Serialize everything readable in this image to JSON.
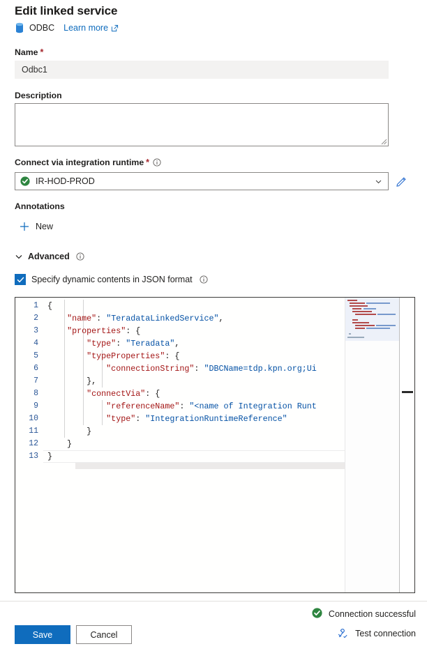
{
  "header": {
    "title": "Edit linked service",
    "service_icon": "database-icon",
    "service_name": "ODBC",
    "learn_more_label": "Learn more",
    "learn_more_icon": "external-link-icon"
  },
  "fields": {
    "name": {
      "label": "Name",
      "required_marker": "*",
      "value": "Odbc1"
    },
    "description": {
      "label": "Description",
      "value": "",
      "placeholder": ""
    },
    "integration_runtime": {
      "label": "Connect via integration runtime",
      "required_marker": "*",
      "info_icon": "info-icon",
      "value": "IR-HOD-PROD",
      "status_icon": "check-circle-green-icon",
      "chevron_icon": "chevron-down-icon",
      "edit_icon": "pencil-icon"
    }
  },
  "annotations": {
    "label": "Annotations",
    "new_label": "New",
    "new_icon": "plus-icon"
  },
  "advanced": {
    "label": "Advanced",
    "chevron_icon": "chevron-down-icon",
    "info_icon": "info-icon",
    "checkbox": {
      "label": "Specify dynamic contents in JSON format",
      "checked": true,
      "info_icon": "info-icon"
    }
  },
  "editor": {
    "line_numbers": [
      "1",
      "2",
      "3",
      "4",
      "5",
      "6",
      "7",
      "8",
      "9",
      "10",
      "11",
      "12",
      "13"
    ],
    "lines": [
      [
        {
          "t": "{",
          "c": "p"
        }
      ],
      [
        {
          "t": "    ",
          "c": "p"
        },
        {
          "t": "\"name\"",
          "c": "k"
        },
        {
          "t": ": ",
          "c": "p"
        },
        {
          "t": "\"TeradataLinkedService\"",
          "c": "s"
        },
        {
          "t": ",",
          "c": "p"
        }
      ],
      [
        {
          "t": "    ",
          "c": "p"
        },
        {
          "t": "\"properties\"",
          "c": "k"
        },
        {
          "t": ": {",
          "c": "p"
        }
      ],
      [
        {
          "t": "        ",
          "c": "p"
        },
        {
          "t": "\"type\"",
          "c": "k"
        },
        {
          "t": ": ",
          "c": "p"
        },
        {
          "t": "\"Teradata\"",
          "c": "s"
        },
        {
          "t": ",",
          "c": "p"
        }
      ],
      [
        {
          "t": "        ",
          "c": "p"
        },
        {
          "t": "\"typeProperties\"",
          "c": "k"
        },
        {
          "t": ": {",
          "c": "p"
        }
      ],
      [
        {
          "t": "            ",
          "c": "p"
        },
        {
          "t": "\"connectionString\"",
          "c": "k"
        },
        {
          "t": ": ",
          "c": "p"
        },
        {
          "t": "\"DBCName=tdp.kpn.org;Ui",
          "c": "s"
        }
      ],
      [
        {
          "t": "        },",
          "c": "p"
        }
      ],
      [
        {
          "t": "        ",
          "c": "p"
        },
        {
          "t": "\"connectVia\"",
          "c": "k"
        },
        {
          "t": ": {",
          "c": "p"
        }
      ],
      [
        {
          "t": "            ",
          "c": "p"
        },
        {
          "t": "\"referenceName\"",
          "c": "k"
        },
        {
          "t": ": ",
          "c": "p"
        },
        {
          "t": "\"<name of Integration Runt",
          "c": "s"
        }
      ],
      [
        {
          "t": "            ",
          "c": "p"
        },
        {
          "t": "\"type\"",
          "c": "k"
        },
        {
          "t": ": ",
          "c": "p"
        },
        {
          "t": "\"IntegrationRuntimeReference\"",
          "c": "s"
        }
      ],
      [
        {
          "t": "        }",
          "c": "p"
        }
      ],
      [
        {
          "t": "    }",
          "c": "p"
        }
      ],
      [
        {
          "t": "}",
          "c": "p"
        }
      ]
    ]
  },
  "footer": {
    "save_label": "Save",
    "cancel_label": "Cancel",
    "connection_status": "Connection successful",
    "connection_status_icon": "check-circle-green-icon",
    "test_connection_label": "Test connection",
    "test_connection_icon": "plug-icon"
  },
  "colors": {
    "accent": "#0f6cbd",
    "success": "#2e8540",
    "required": "#a4262c",
    "json_key": "#a31515",
    "json_string": "#0451a5",
    "line_number": "#2b5797"
  }
}
